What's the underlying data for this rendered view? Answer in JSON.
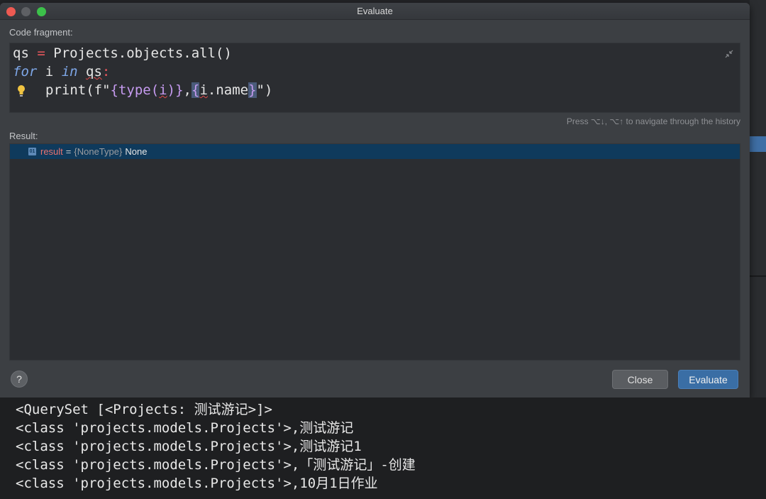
{
  "window": {
    "title": "Evaluate"
  },
  "code_fragment": {
    "label": "Code fragment:",
    "lines": {
      "l1_a": "qs",
      "l1_op": "=",
      "l1_b": "Projects.objects.all()",
      "l2_kw1": "for",
      "l2_a": "i",
      "l2_kw2": "in",
      "l2_b": "qs",
      "l2_c": ":",
      "l3_a": "print(f\"",
      "l3_b1": "{",
      "l3_c": "type(",
      "l3_d": "i",
      "l3_e": ")",
      "l3_b2": "}",
      "l3_f": ",",
      "l3_b3": "{",
      "l3_g": "i",
      "l3_h": ".name",
      "l3_b4": "}",
      "l3_i": "\")"
    },
    "history_hint": "Press ⌥↓, ⌥↑ to navigate through the history"
  },
  "result": {
    "label": "Result:",
    "icon_text": "01",
    "name": "result",
    "eq": "=",
    "type": "{NoneType}",
    "value": "None"
  },
  "buttons": {
    "help": "?",
    "close": "Close",
    "evaluate": "Evaluate"
  },
  "console": {
    "lines": [
      "<QuerySet [<Projects: 测试游记>]>",
      "<class 'projects.models.Projects'>,测试游记",
      "<class 'projects.models.Projects'>,测试游记1",
      "<class 'projects.models.Projects'>,「测试游记」-创建",
      "<class 'projects.models.Projects'>,10月1日作业"
    ]
  },
  "colors": {
    "accent": "#3a6ea5",
    "selection": "#0f3a5c",
    "close_light": "#ee5a52",
    "max_light": "#3cc14a"
  }
}
